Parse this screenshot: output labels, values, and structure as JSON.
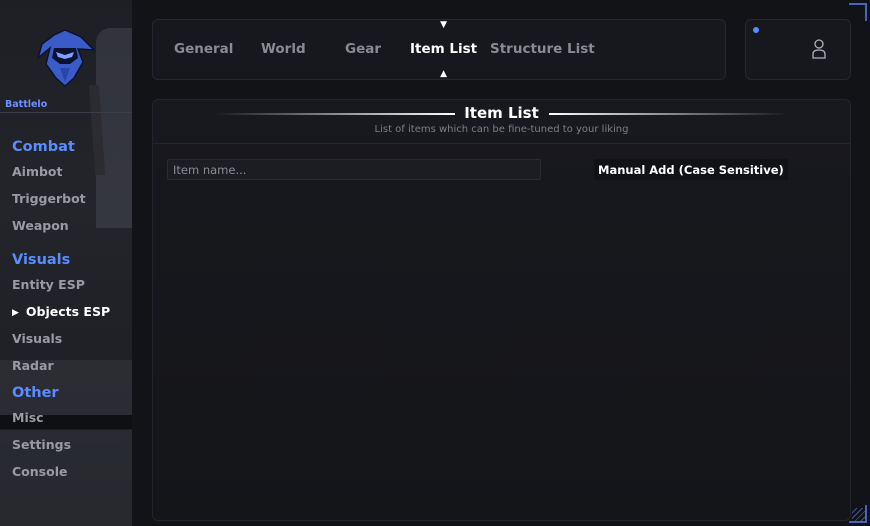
{
  "sidebar": {
    "brand": "Battlelog",
    "logo_icon": "hooded-knight-icon",
    "sections": [
      {
        "title": "Combat",
        "items": [
          "Aimbot",
          "Triggerbot",
          "Weapon"
        ]
      },
      {
        "title": "Visuals",
        "items": [
          "Entity ESP",
          "Objects ESP",
          "Visuals",
          "Radar"
        ]
      },
      {
        "title": "Other",
        "items": [
          "Misc",
          "Settings",
          "Console"
        ]
      }
    ],
    "active_item": "Objects ESP"
  },
  "tabs": [
    "General",
    "World",
    "Gear",
    "Item List",
    "Structure List"
  ],
  "active_tab": "Item List",
  "user": {
    "icon": "user-icon",
    "status_color": "#5b8cff"
  },
  "panel": {
    "title": "Item List",
    "subtitle": "List of items which can be fine-tuned to your liking",
    "search": {
      "placeholder": "Item name...",
      "value": ""
    },
    "add_button": "Manual Add (Case Sensitive)"
  },
  "colors": {
    "accent": "#5b8cff",
    "background": "#121317",
    "panel": "#17181d"
  }
}
